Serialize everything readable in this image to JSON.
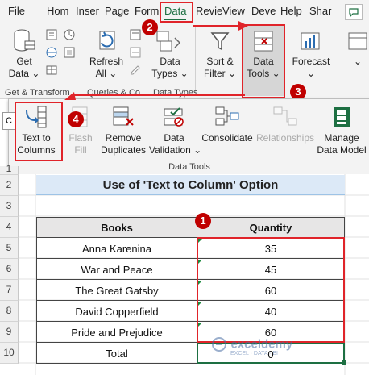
{
  "tabs": [
    "File",
    "Hom",
    "Inser",
    "Page",
    "Form",
    "Data",
    "Revie",
    "View",
    "Deve",
    "Help",
    "Shar"
  ],
  "active_tab": "Data",
  "ribbon": {
    "get_data": [
      "Get",
      "Data"
    ],
    "refresh": [
      "Refresh",
      "All"
    ],
    "data_types": [
      "Data",
      "Types"
    ],
    "sort_filter": [
      "Sort &",
      "Filter"
    ],
    "data_tools": [
      "Data",
      "Tools"
    ],
    "forecast": "Forecast",
    "groups": [
      "Get & Transform",
      "Queries & Co",
      "Data Types"
    ]
  },
  "popup": {
    "buttons": {
      "text_to_columns": [
        "Text to",
        "Columns"
      ],
      "flash_fill": [
        "Flash",
        "Fill"
      ],
      "remove_duplicates": [
        "Remove",
        "Duplicates"
      ],
      "data_validation": [
        "Data",
        "Validation"
      ],
      "consolidate": "Consolidate",
      "relationships": "Relationships",
      "manage_data_model": [
        "Manage",
        "Data Model"
      ]
    },
    "group_label": "Data Tools"
  },
  "sheet": {
    "title": "Use of 'Text to Column' Option",
    "headers": [
      "Books",
      "Quantity"
    ],
    "rows": [
      {
        "book": "Anna Karenina",
        "qty": "35"
      },
      {
        "book": "War and Peace",
        "qty": "45"
      },
      {
        "book": "The Great Gatsby",
        "qty": "60"
      },
      {
        "book": "David Copperfield",
        "qty": "40"
      },
      {
        "book": "Pride and Prejudice",
        "qty": "60"
      }
    ],
    "total_label": "Total",
    "total_value": "0",
    "row_numbers": [
      "1",
      "2",
      "3",
      "4",
      "5",
      "6",
      "7",
      "8",
      "9",
      "10"
    ]
  },
  "badges": [
    "1",
    "2",
    "3",
    "4"
  ],
  "watermark": "exceldemy",
  "watermark_sub": "EXCEL · DATA · BI",
  "colors": {
    "accent": "#1d6f42",
    "callout": "#e0242a",
    "title_fill": "#dce9f7",
    "header_fill": "#e7e6e6"
  }
}
